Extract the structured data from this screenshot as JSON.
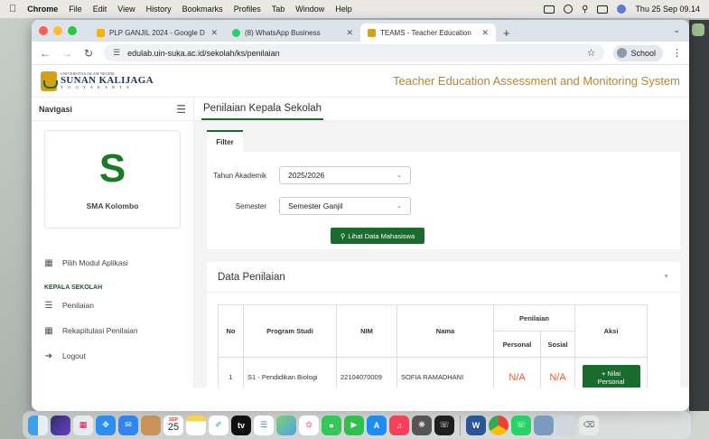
{
  "menubar": {
    "app": "Chrome",
    "items": [
      "File",
      "Edit",
      "View",
      "History",
      "Bookmarks",
      "Profiles",
      "Tab",
      "Window",
      "Help"
    ],
    "clock": "Thu 25 Sep 09.14"
  },
  "browser": {
    "tabs": [
      {
        "title": "PLP GANJIL 2024 - Google D",
        "active": false,
        "color": "#f4b400"
      },
      {
        "title": "(8) WhatsApp Business",
        "active": false,
        "color": "#25d366"
      },
      {
        "title": "TEAMS - Teacher Education",
        "active": true,
        "color": "#d4a017"
      }
    ],
    "url": "edulab.uin-suka.ac.id/sekolah/ks/penilaian",
    "profile_label": "School"
  },
  "site": {
    "logo_small": "UNIVERSITAS ISLAM NEGERI",
    "logo_big": "SUNAN KALIJAGA",
    "logo_city": "Y O G Y A K A R T A",
    "title": "Teacher Education Assessment and Monitoring System"
  },
  "sidebar": {
    "heading": "Navigasi",
    "school_initial": "S",
    "school_name": "SMA Kolombo",
    "module_item": "Pilih Modul Aplikasi",
    "section": "KEPALA SEKOLAH",
    "items": [
      "Penilaian",
      "Rekapitulasi Penilaian",
      "Logout"
    ]
  },
  "main": {
    "page_title": "Penilaian Kepala Sekolah",
    "filter": {
      "tab_label": "Filter",
      "year_label": "Tahun Akademik",
      "year_value": "2025/2026",
      "semester_label": "Semester",
      "semester_value": "Semester Ganjil",
      "button_label": "Lihat Data Mahasiswa"
    },
    "data": {
      "heading": "Data Penilaian",
      "headers": {
        "no": "No",
        "program": "Program Studi",
        "nim": "NIM",
        "nama": "Nama",
        "penilaian": "Penilaian",
        "personal": "Personal",
        "sosial": "Sosial",
        "aksi": "Aksi"
      },
      "rows": [
        {
          "no": "1",
          "program": "S1 - Pendidikan Biologi",
          "nim": "22104070009",
          "nama": "SOFIA RAMADHANI",
          "personal": "N/A",
          "sosial": "N/A",
          "action_line1": "+ Nilai",
          "action_line2": "Personal"
        }
      ]
    }
  },
  "dock": {
    "calendar_month": "SEP",
    "calendar_day": "25"
  }
}
